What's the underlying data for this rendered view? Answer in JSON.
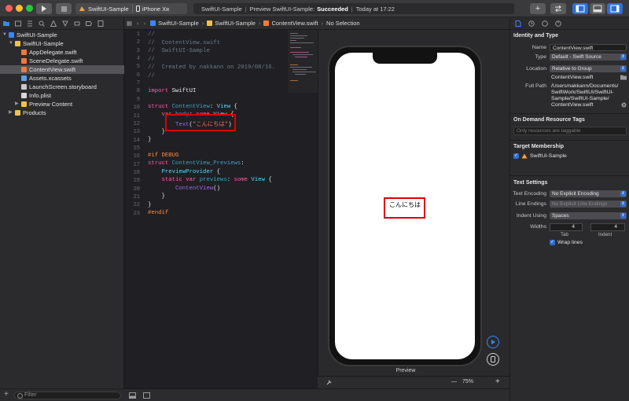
{
  "toolbar": {
    "scheme_app": "SwiftUI-Sample",
    "scheme_device": "iPhone Xʀ",
    "status_project": "SwiftUI-Sample",
    "status_action": "Preview SwiftUI-Sample:",
    "status_result": "Succeeded",
    "status_time": "Today at 17:22",
    "add_label": "+"
  },
  "navigator": {
    "items": [
      {
        "label": "SwiftUI-Sample"
      },
      {
        "label": "SwiftUI-Sample"
      },
      {
        "label": "AppDelegate.swift"
      },
      {
        "label": "SceneDelegate.swift"
      },
      {
        "label": "ContentView.swift"
      },
      {
        "label": "Assets.xcassets"
      },
      {
        "label": "LaunchScreen.storyboard"
      },
      {
        "label": "Info.plist"
      },
      {
        "label": "Preview Content"
      },
      {
        "label": "Products"
      }
    ],
    "filter_placeholder": "Filter"
  },
  "jumpbar": {
    "crumb1": "SwiftUI-Sample",
    "crumb2": "SwiftUI-Sample",
    "crumb3": "ContentView.swift",
    "crumb4": "No Selection"
  },
  "editor": {
    "line_numbers": [
      "1",
      "2",
      "3",
      "4",
      "5",
      "6",
      "7",
      "8",
      "9",
      "10",
      "11",
      "12",
      "13",
      "14",
      "15",
      "16",
      "17",
      "18",
      "19",
      "20",
      "21",
      "22",
      "23"
    ],
    "l1": "//",
    "l2": "//  ContentView.swift",
    "l3": "//  SwiftUI-Sample",
    "l4": "//",
    "l5": "//  Created by nakkann on 2019/08/16.",
    "l6": "//",
    "l8_kw": "import",
    "l8_mod": "SwiftUI",
    "l10_kw": "struct",
    "l10_name": "ContentView",
    "l10_type": "View",
    "l11_kw1": "var",
    "l11_name": "body",
    "l11_kw2": "some",
    "l11_type": "View",
    "l12_fn": "Text",
    "l12_str": "\"こんにちは\"",
    "l16_pre": "#if DEBUG",
    "l17_kw": "struct",
    "l17_name": "ContentView_Previews",
    "l18_type": "PreviewProvider",
    "l19_kw1": "static",
    "l19_kw2": "var",
    "l19_name": "previews",
    "l19_kw3": "some",
    "l19_type": "View",
    "l20_fn": "ContentView",
    "l23_pre": "#endif"
  },
  "preview": {
    "text": "こんにちは",
    "label": "Preview",
    "zoom": "75%",
    "zoom_minus": "—",
    "zoom_plus": "+"
  },
  "inspector": {
    "identity_title": "Identity and Type",
    "name_label": "Name",
    "name_value": "ContentView.swift",
    "type_label": "Type",
    "type_value": "Default - Swift Source",
    "location_label": "Location",
    "location_value": "Relative to Group",
    "location_file": "ContentView.swift",
    "fullpath_label": "Full Path",
    "fullpath_lines": [
      "/Users/nakkann/Documents/",
      "SwiftWork/SwiftUI/SwiftUI-",
      "Sample/SwiftUI-Sample/",
      "ContentView.swift"
    ],
    "odr_title": "On Demand Resource Tags",
    "odr_placeholder": "Only resources are taggable",
    "target_title": "Target Membership",
    "target_name": "SwiftUI-Sample",
    "text_title": "Text Settings",
    "encoding_label": "Text Encoding",
    "encoding_value": "No Explicit Encoding",
    "endings_label": "Line Endings",
    "endings_value": "No Explicit Line Endings",
    "indent_label": "Indent Using",
    "indent_value": "Spaces",
    "widths_label": "Widths",
    "tab_value": "4",
    "indent_width_value": "4",
    "tab_label": "Tab",
    "indent_sub_label": "Indent",
    "wrap_label": "Wrap lines"
  },
  "colors": {
    "accent": "#2f6fd6",
    "highlight": "#e00000"
  }
}
